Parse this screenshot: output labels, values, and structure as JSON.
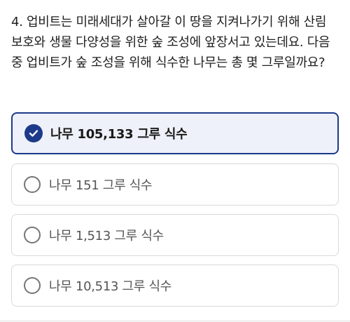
{
  "question": {
    "text": "4. 업비트는 미래세대가 살아갈 이 땅을 지켜나가기 위해 산림 보호와 생물 다양성을 위한 숲 조성에 앞장서고 있는데요. 다음 중 업비트가 숲 조성을 위해 식수한 나무는 총 몇 그루일까요?"
  },
  "options": [
    {
      "label": "나무 105,133 그루 식수",
      "selected": true
    },
    {
      "label": "나무 151 그루 식수",
      "selected": false
    },
    {
      "label": "나무 1,513 그루 식수",
      "selected": false
    },
    {
      "label": "나무 10,513 그루 식수",
      "selected": false
    }
  ],
  "colors": {
    "accent": "#1d3a8a",
    "selected_background": "#eef1f9",
    "option_border": "#d9d9d9",
    "radio_border": "#757575"
  },
  "icons": {
    "selected_option": "check-circle-icon",
    "unselected_option": "radio-circle-icon"
  }
}
